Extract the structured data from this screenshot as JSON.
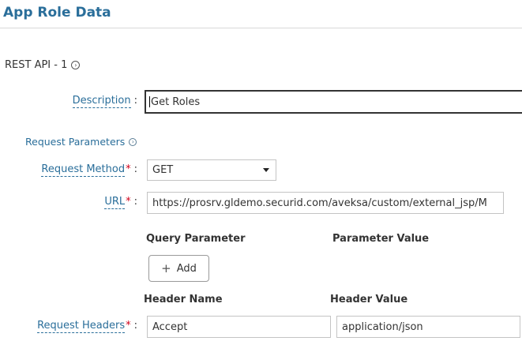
{
  "page": {
    "title": "App Role Data"
  },
  "section": {
    "title": "REST API - 1"
  },
  "description": {
    "label": "Description",
    "colon": ":",
    "value": "Get Roles"
  },
  "request_parameters": {
    "label": "Request Parameters"
  },
  "request_method": {
    "label": "Request Method",
    "required_mark": "*",
    "colon": ":",
    "selected": "GET"
  },
  "url": {
    "label": "URL",
    "required_mark": "*",
    "colon": ":",
    "value": "https://prosrv.gldemo.securid.com/aveksa/custom/external_jsp/M"
  },
  "query": {
    "col_name": "Query Parameter",
    "col_value": "Parameter Value",
    "add_label": "Add"
  },
  "headers": {
    "col_name": "Header Name",
    "col_value": "Header Value",
    "label": "Request Headers",
    "required_mark": "*",
    "colon": ":",
    "rows": [
      {
        "name": "Accept",
        "value": "application/json"
      }
    ]
  },
  "colors": {
    "accent": "#2a6e9a",
    "required": "#d0021b"
  }
}
